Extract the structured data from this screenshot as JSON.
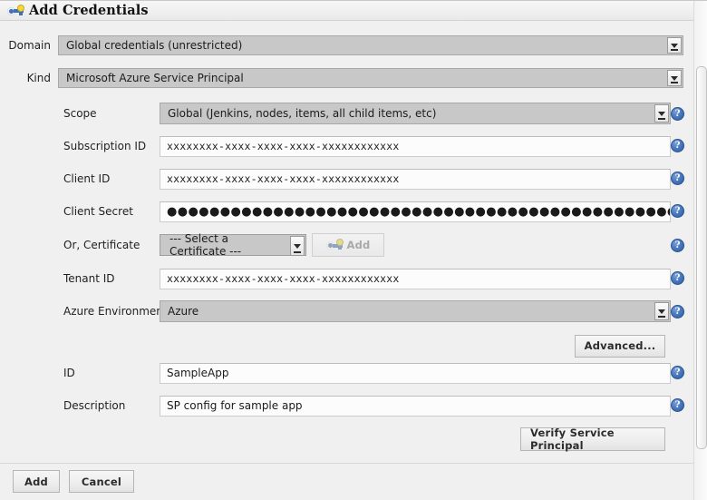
{
  "window": {
    "title": "Add Credentials",
    "title_icon": "key-icon"
  },
  "top_fields": [
    {
      "label": "Domain",
      "value": "Global credentials (unrestricted)",
      "control": "select",
      "name": "domain"
    },
    {
      "label": "Kind",
      "value": "Microsoft Azure Service Principal",
      "control": "select",
      "name": "kind"
    }
  ],
  "form": {
    "scope": {
      "label": "Scope",
      "value": "Global (Jenkins, nodes, items, all child items, etc)"
    },
    "subscription_id": {
      "label": "Subscription ID",
      "value": "xxxxxxxx-xxxx-xxxx-xxxx-xxxxxxxxxxxx"
    },
    "client_id": {
      "label": "Client ID",
      "value": "xxxxxxxx-xxxx-xxxx-xxxx-xxxxxxxxxxxx"
    },
    "client_secret": {
      "label": "Client Secret",
      "value": "●●●●●●●●●●●●●●●●●●●●●●●●●●●●●●●●●●●●●●●●●●●●●●●●●●"
    },
    "certificate": {
      "label": "Or, Certificate",
      "value": "--- Select a Certificate ---",
      "add_button": "Add"
    },
    "tenant_id": {
      "label": "Tenant ID",
      "value": "xxxxxxxx-xxxx-xxxx-xxxx-xxxxxxxxxxxx"
    },
    "azure_environment": {
      "label": "Azure Environment",
      "value": "Azure"
    },
    "advanced_button": "Advanced...",
    "id": {
      "label": "ID",
      "value": "SampleApp"
    },
    "description": {
      "label": "Description",
      "value": "SP config for sample app"
    },
    "verify_button": "Verify Service Principal"
  },
  "footer": {
    "add_label": "Add",
    "cancel_label": "Cancel"
  },
  "icons": {
    "help": "?"
  },
  "colors": {
    "page_background": "#f0f0f0",
    "select_background": "#c8c8c8",
    "input_background": "#fcfcfc",
    "help_icon": "#2f5ba3",
    "key_icon_body": "#3f6fb5",
    "key_icon_dot": "#f5d93a"
  }
}
